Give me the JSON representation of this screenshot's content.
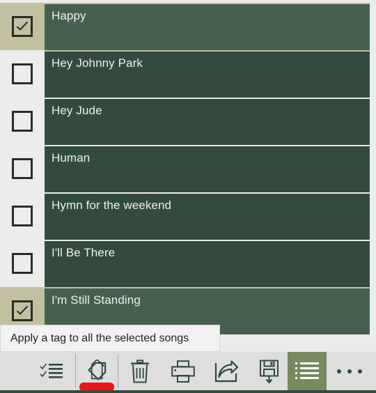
{
  "app": {
    "accent_green": "#334b3e",
    "selected_row_green": "#46604f",
    "selected_gutter_khaki": "#c2c0a0",
    "toolbar_bg": "#dedede",
    "active_button_green": "#768a5e",
    "indicator_red": "#e61919",
    "text_light": "#eef0ee"
  },
  "song_list": {
    "rows": [
      {
        "title": "Happy",
        "checked": true
      },
      {
        "title": "Hey Johnny Park",
        "checked": false
      },
      {
        "title": "Hey Jude",
        "checked": false
      },
      {
        "title": "Human",
        "checked": false
      },
      {
        "title": "Hymn for the weekend",
        "checked": false
      },
      {
        "title": "I'll Be There",
        "checked": false
      },
      {
        "title": "I'm Still Standing",
        "checked": true
      }
    ]
  },
  "tooltip": {
    "text": "Apply a tag to all the selected songs"
  },
  "toolbar": {
    "buttons": [
      {
        "name": "select-all",
        "icon": "checklist-icon",
        "active": false,
        "indicator": false
      },
      {
        "name": "apply-tag",
        "icon": "tag-icon",
        "active": false,
        "indicator": true
      },
      {
        "name": "delete",
        "icon": "trash-icon",
        "active": false,
        "indicator": false
      },
      {
        "name": "print",
        "icon": "printer-icon",
        "active": false,
        "indicator": false
      },
      {
        "name": "share",
        "icon": "share-icon",
        "active": false,
        "indicator": false
      },
      {
        "name": "save",
        "icon": "save-icon",
        "active": false,
        "indicator": false
      },
      {
        "name": "list-view",
        "icon": "list-icon",
        "active": true,
        "indicator": false
      },
      {
        "name": "more",
        "icon": "overflow-dots-icon",
        "active": false,
        "indicator": false
      }
    ]
  }
}
